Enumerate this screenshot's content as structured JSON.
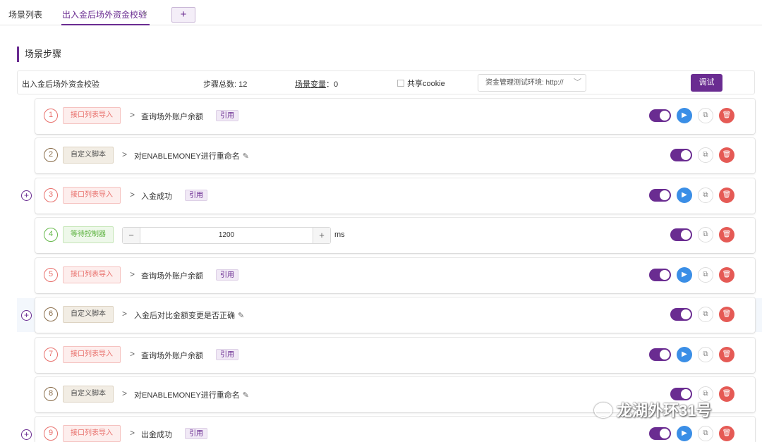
{
  "tabs": [
    {
      "label": "场景列表"
    },
    {
      "label": "出入金后场外资金校验",
      "close": "×"
    }
  ],
  "tab_add": "+",
  "section_title": "场景步骤",
  "info": {
    "name": "出入金后场外资金校验",
    "total_label": "步骤总数: 12",
    "var_label": "场景变量",
    "var_value": "：0",
    "cookie_label": "共享cookie",
    "env_label": "资金管理测试环境: http://",
    "debug": "调试"
  },
  "steps": [
    {
      "num": "1",
      "tag": "接口列表导入",
      "chevron": ">",
      "title": "查询场外账户余额",
      "ref": "引用"
    },
    {
      "num": "2",
      "tag": "自定义脚本",
      "chevron": ">",
      "title": "对ENABLEMONEY进行重命名",
      "edit": "✎"
    },
    {
      "num": "3",
      "tag": "接口列表导入",
      "chevron": ">",
      "title": "入金成功",
      "ref": "引用"
    },
    {
      "num": "4",
      "tag": "等待控制器",
      "minus": "−",
      "value": "1200",
      "plus": "+",
      "unit": "ms"
    },
    {
      "num": "5",
      "tag": "接口列表导入",
      "chevron": ">",
      "title": "查询场外账户余额",
      "ref": "引用"
    },
    {
      "num": "6",
      "tag": "自定义脚本",
      "chevron": ">",
      "title": "入金后对比金额变更是否正确",
      "edit": "✎"
    },
    {
      "num": "7",
      "tag": "接口列表导入",
      "chevron": ">",
      "title": "查询场外账户余额",
      "ref": "引用"
    },
    {
      "num": "8",
      "tag": "自定义脚本",
      "chevron": ">",
      "title": "对ENABLEMONEY进行重命名",
      "edit": "✎"
    },
    {
      "num": "9",
      "tag": "接口列表导入",
      "chevron": ">",
      "title": "出金成功",
      "ref": "引用"
    }
  ],
  "add_icon": "+",
  "watermark": "龙湖外环31号",
  "colors": {
    "accent": "#6a2c91",
    "red": "#e8706c",
    "blue": "#3a8ee6",
    "green": "#66b84a"
  }
}
